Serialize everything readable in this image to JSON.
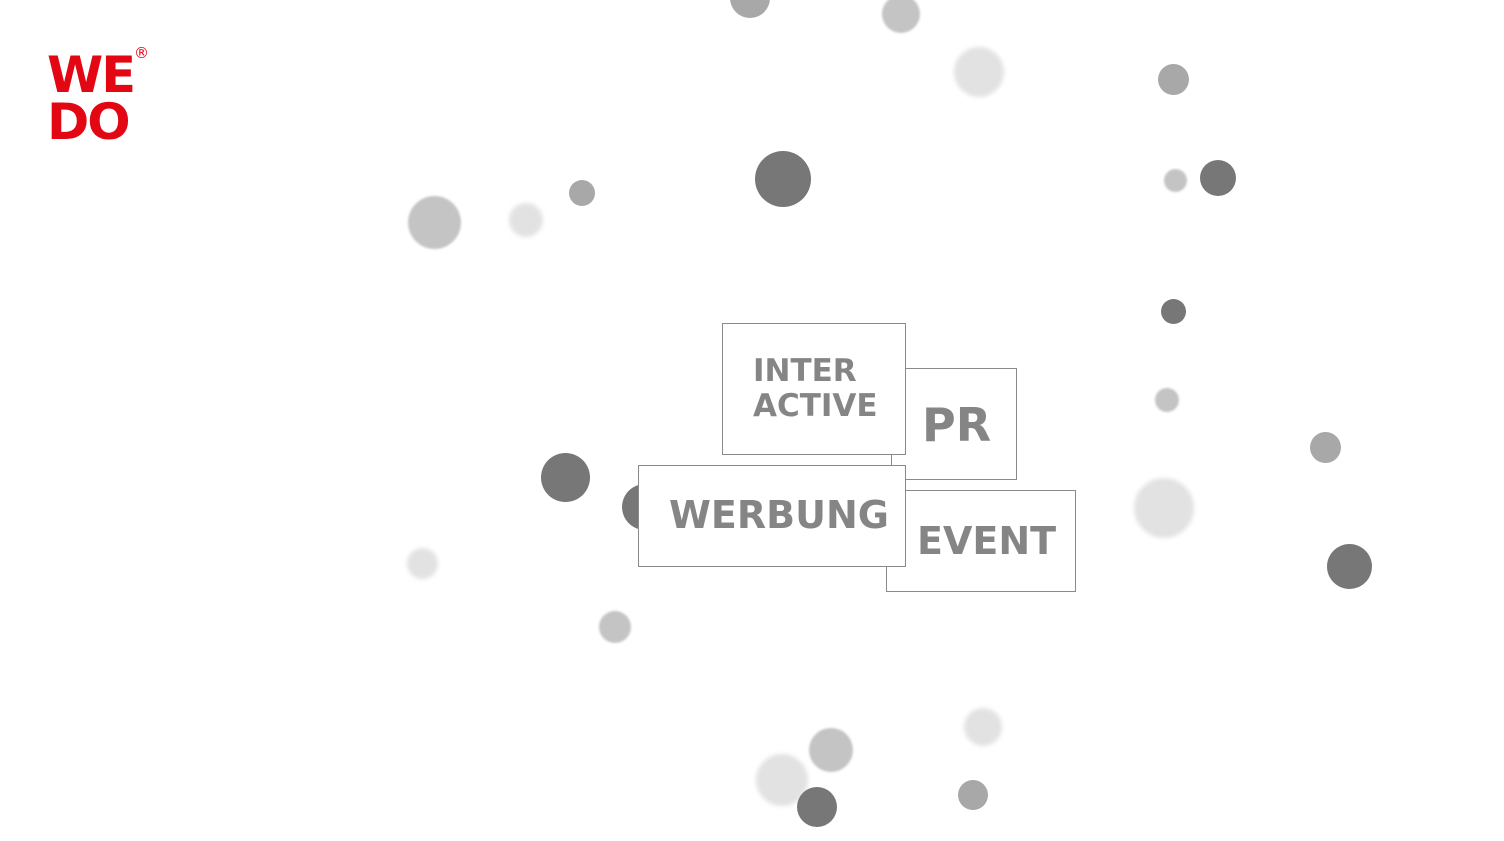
{
  "logo": {
    "line1": "WE",
    "line2": "DO",
    "registered": "®",
    "color": "#e30613"
  },
  "nav": {
    "interactive": "INTER\nACTIVE",
    "pr": "PR",
    "werbung": "WERBUNG",
    "event": "EVENT"
  },
  "colors": {
    "label": "#858585",
    "border": "#8a8a8a",
    "bubble_dark": "#777777",
    "bubble_mid": "#a8a8a8",
    "bubble_light": "#c4c4c4",
    "bubble_faint": "#e2e2e2"
  }
}
